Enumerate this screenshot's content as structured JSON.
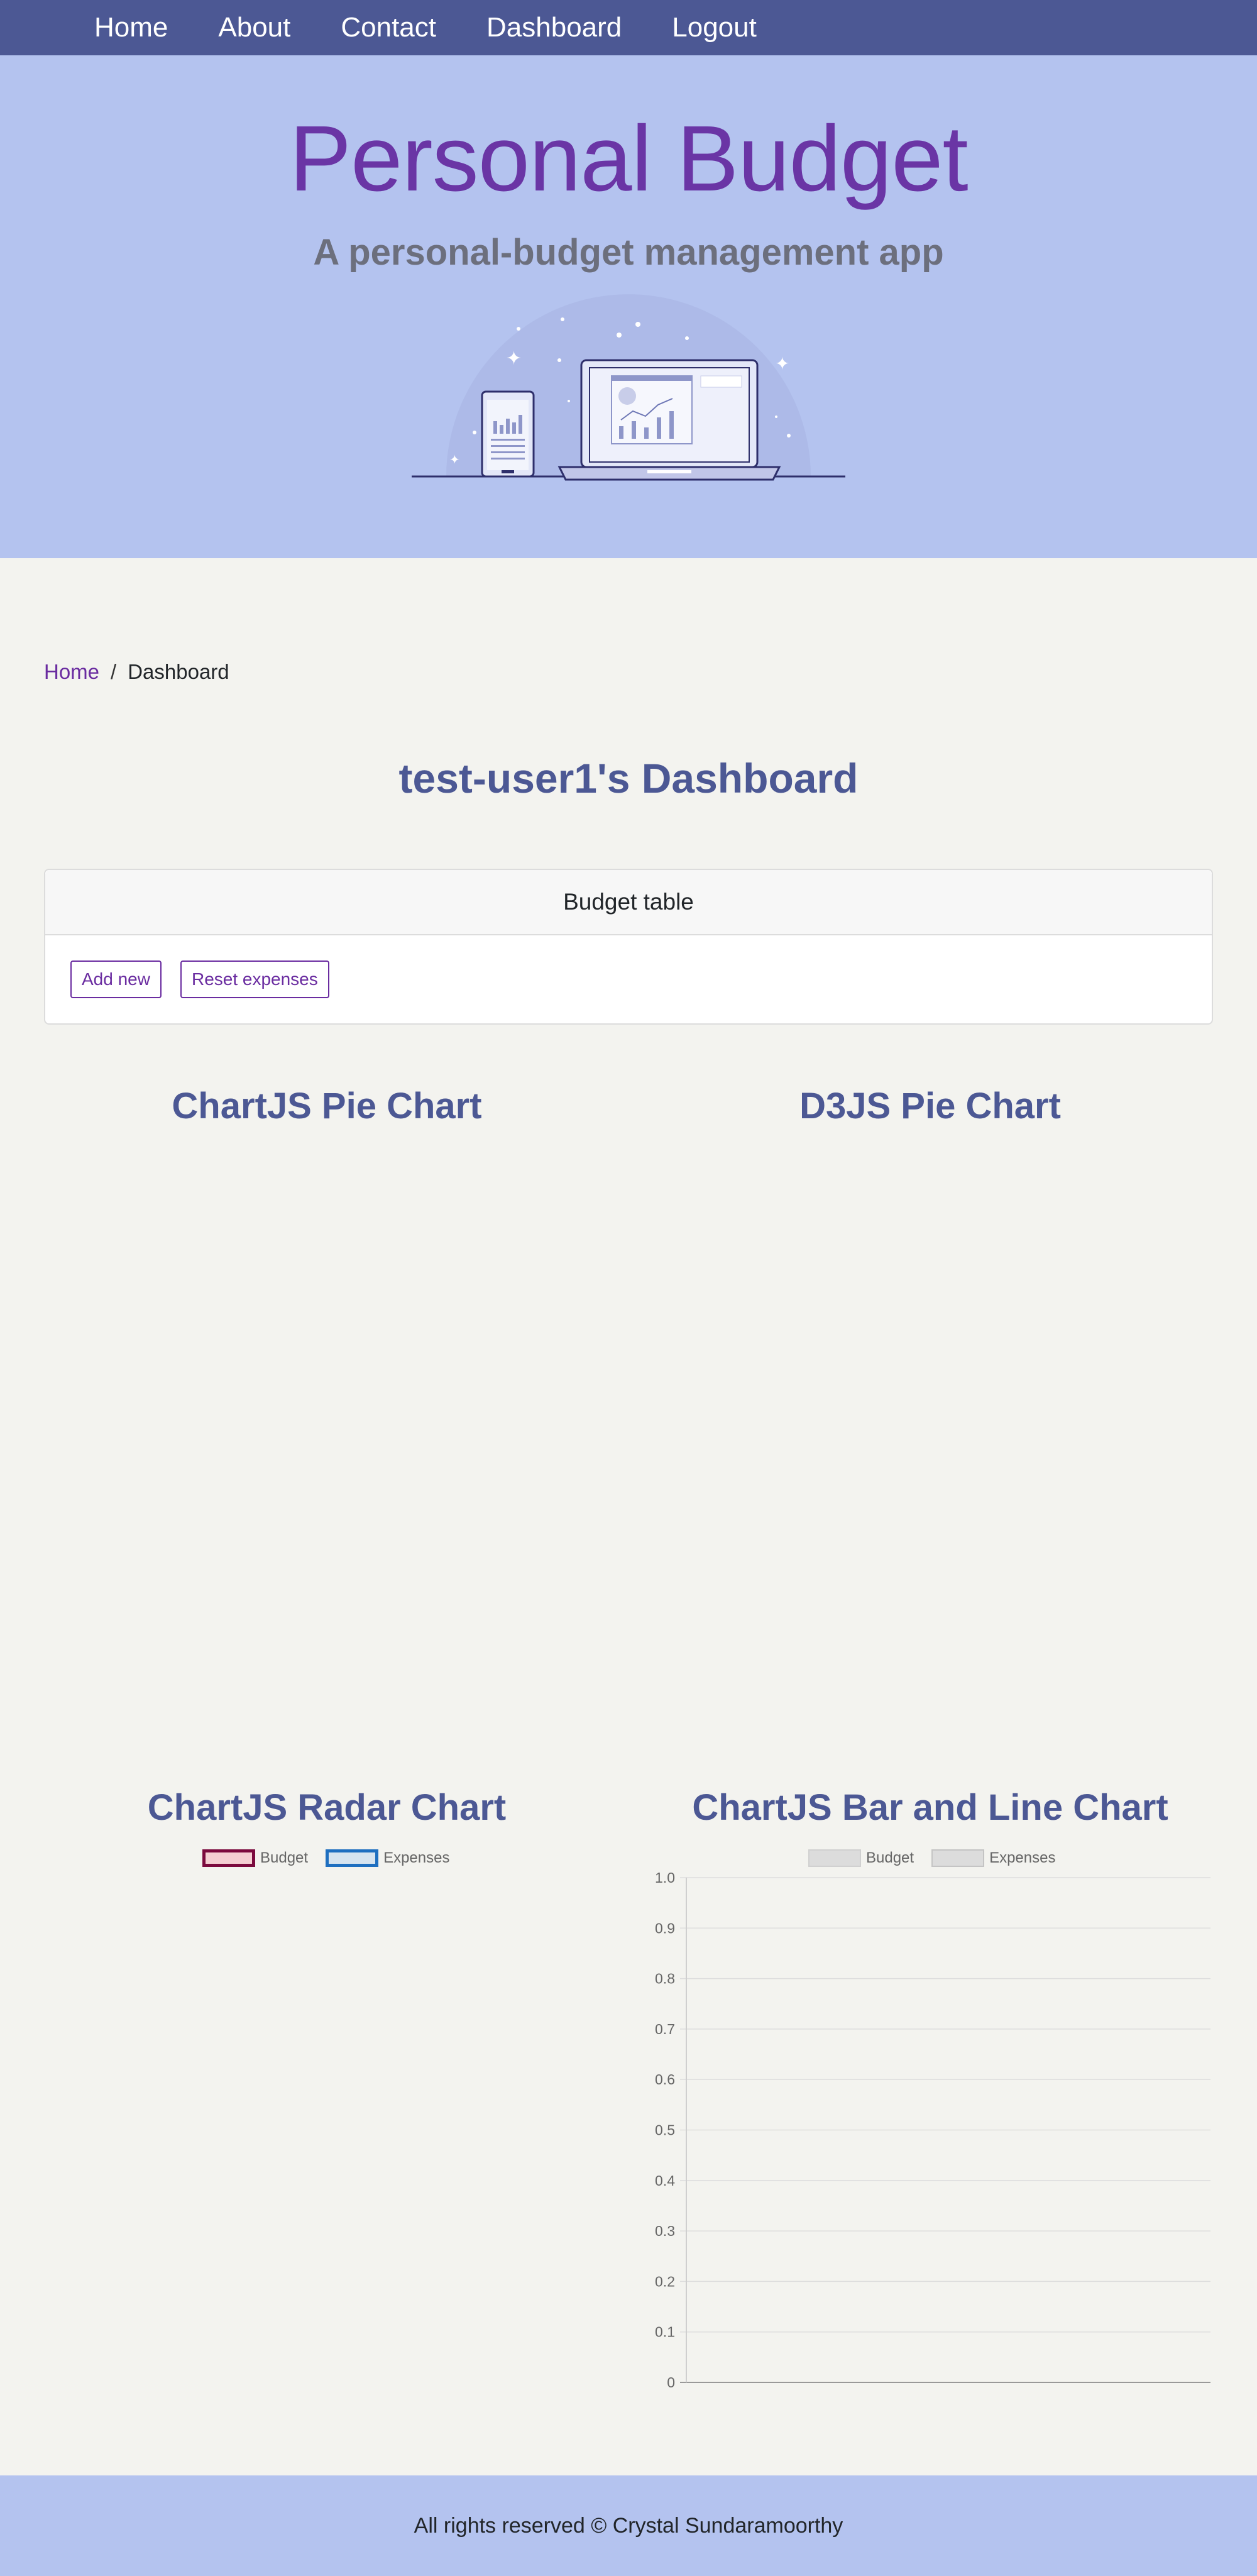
{
  "nav": {
    "items": [
      "Home",
      "About",
      "Contact",
      "Dashboard",
      "Logout"
    ]
  },
  "hero": {
    "title": "Personal Budget",
    "subtitle": "A personal-budget management app"
  },
  "breadcrumb": {
    "home": "Home",
    "separator": "/",
    "current": "Dashboard"
  },
  "dashboard": {
    "title": "test-user1's Dashboard"
  },
  "budget_card": {
    "header": "Budget table",
    "add_label": "Add new",
    "reset_label": "Reset expenses"
  },
  "sections": {
    "chartjs_pie": "ChartJS Pie Chart",
    "d3_pie": "D3JS Pie Chart",
    "radar": "ChartJS Radar Chart",
    "bar_line": "ChartJS Bar and Line Chart"
  },
  "colors": {
    "nav_bg": "#4c5894",
    "hero_bg": "#b4c3ef",
    "accent": "#6a2ca0",
    "heading": "#4c5894",
    "budget_border": "#7b0a3e",
    "budget_fill": "#f4cfd3",
    "expenses_border": "#1e6fc0",
    "expenses_fill": "#d6e4f0"
  },
  "radar_legend": [
    "Budget",
    "Expenses"
  ],
  "chart_data": {
    "type": "bar",
    "categories": [],
    "series": [
      {
        "name": "Budget",
        "values": []
      },
      {
        "name": "Expenses",
        "values": []
      }
    ],
    "yticks": [
      "0",
      "0.1",
      "0.2",
      "0.3",
      "0.4",
      "0.5",
      "0.6",
      "0.7",
      "0.8",
      "0.9",
      "1.0"
    ],
    "ylim": [
      0,
      1.0
    ],
    "grid": true,
    "legend_position": "top"
  },
  "footer": {
    "text": "All rights reserved © Crystal Sundaramoorthy"
  }
}
